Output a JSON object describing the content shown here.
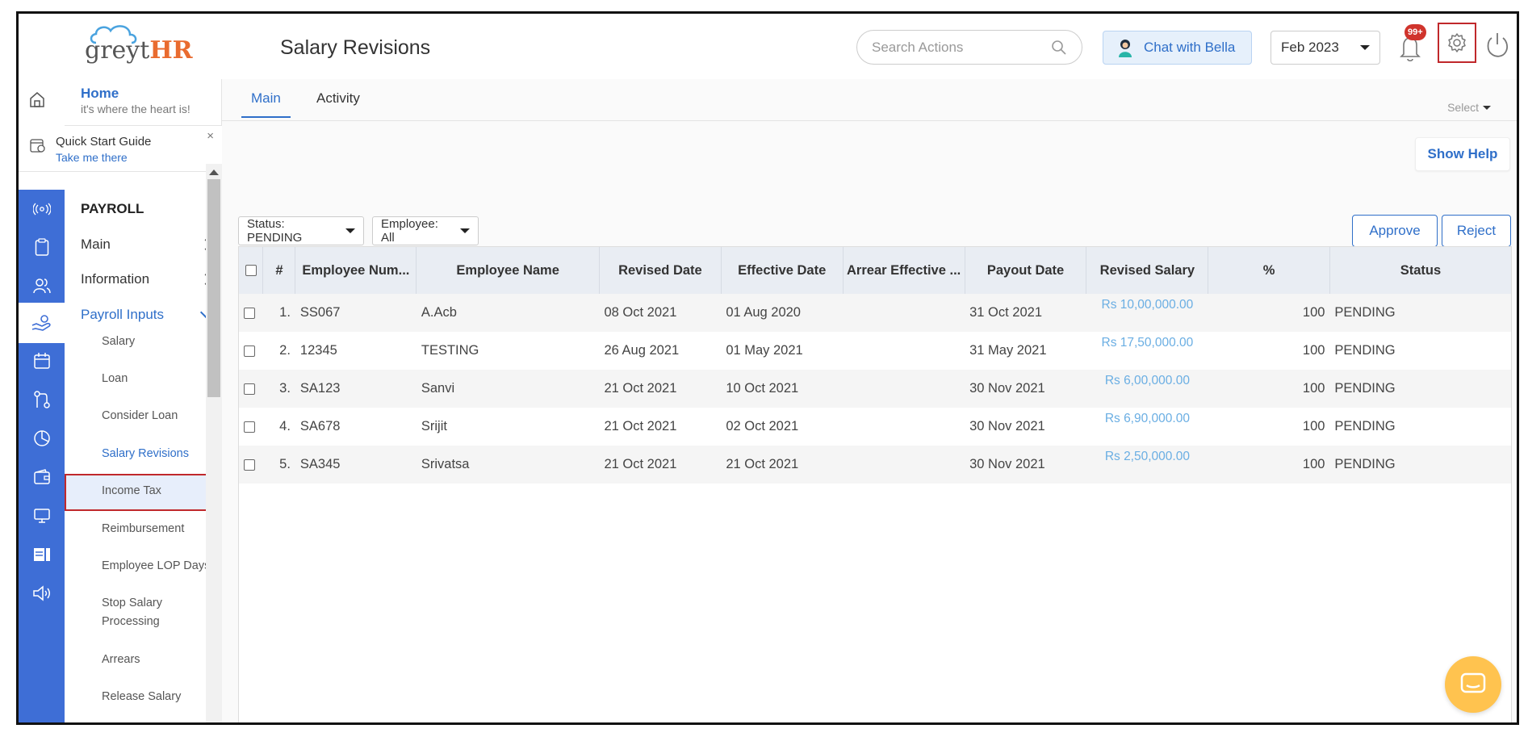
{
  "app": {
    "logo_main": "greyt",
    "logo_accent": "HR"
  },
  "header": {
    "title": "Salary Revisions",
    "search_placeholder": "Search Actions",
    "chat_label": "Chat with Bella",
    "month": "Feb 2023",
    "notification_badge": "99+"
  },
  "sidebar": {
    "home_title": "Home",
    "home_sub": "it's where the heart is!",
    "quickstart_title": "Quick Start Guide",
    "quickstart_sub": "Take me there",
    "quickstart_close": "×",
    "section": "PAYROLL",
    "items": [
      {
        "label": "Main"
      },
      {
        "label": "Information"
      },
      {
        "label": "Payroll Inputs"
      }
    ],
    "sub_items": [
      {
        "label": "Salary"
      },
      {
        "label": "Loan"
      },
      {
        "label": "Consider Loan"
      },
      {
        "label": "Salary Revisions"
      },
      {
        "label": "Income Tax"
      },
      {
        "label": "Reimbursement"
      },
      {
        "label": "Employee LOP Days"
      },
      {
        "label": "Stop Salary"
      },
      {
        "label": "Processing"
      },
      {
        "label": "Arrears"
      },
      {
        "label": "Release Salary"
      }
    ]
  },
  "tabs": [
    {
      "label": "Main"
    },
    {
      "label": "Activity"
    }
  ],
  "select_label": "Select",
  "show_help": "Show Help",
  "filters": {
    "status": "Status: PENDING",
    "employee": "Employee: All"
  },
  "actions": {
    "approve": "Approve",
    "reject": "Reject"
  },
  "table": {
    "columns": [
      "#",
      "Employee Num...",
      "Employee Name",
      "Revised Date",
      "Effective Date",
      "Arrear Effective ...",
      "Payout Date",
      "Revised Salary",
      "%",
      "Status"
    ],
    "rows": [
      {
        "idx": "1.",
        "emp_num": "SS067",
        "name": "A.Acb",
        "revised": "08 Oct 2021",
        "effective": "01 Aug 2020",
        "arrear": "",
        "payout": "31 Oct 2021",
        "salary": "Rs 10,00,000.00",
        "pct": "100",
        "status": "PENDING"
      },
      {
        "idx": "2.",
        "emp_num": "12345",
        "name": "TESTING",
        "revised": "26 Aug 2021",
        "effective": "01 May 2021",
        "arrear": "",
        "payout": "31 May 2021",
        "salary": "Rs 17,50,000.00",
        "pct": "100",
        "status": "PENDING"
      },
      {
        "idx": "3.",
        "emp_num": "SA123",
        "name": "Sanvi",
        "revised": "21 Oct 2021",
        "effective": "10 Oct 2021",
        "arrear": "",
        "payout": "30 Nov 2021",
        "salary": "Rs 6,00,000.00",
        "pct": "100",
        "status": "PENDING"
      },
      {
        "idx": "4.",
        "emp_num": "SA678",
        "name": "Srijit",
        "revised": "21 Oct 2021",
        "effective": "02 Oct 2021",
        "arrear": "",
        "payout": "30 Nov 2021",
        "salary": "Rs 6,90,000.00",
        "pct": "100",
        "status": "PENDING"
      },
      {
        "idx": "5.",
        "emp_num": "SA345",
        "name": "Srivatsa",
        "revised": "21 Oct 2021",
        "effective": "21 Oct 2021",
        "arrear": "",
        "payout": "30 Nov 2021",
        "salary": "Rs 2,50,000.00",
        "pct": "100",
        "status": "PENDING"
      }
    ]
  },
  "colors": {
    "primary": "#2f6fc9",
    "rail": "#3e6ed6",
    "accent_red": "#c0282b",
    "logo_orange": "#e96b2f",
    "fab": "#ffc34f"
  }
}
